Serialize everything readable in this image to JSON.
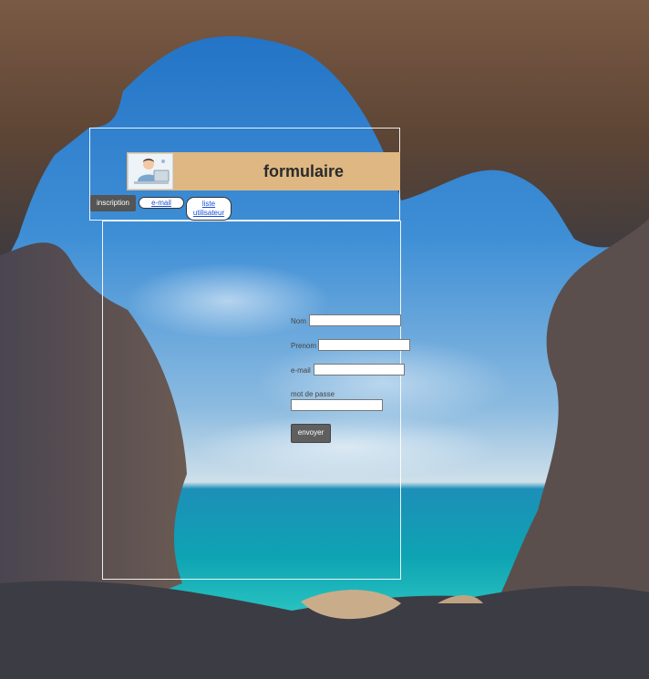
{
  "header": {
    "title": "formulaire"
  },
  "nav": {
    "inscription": "inscription",
    "email": "e-mail",
    "liste_line1": "liste",
    "liste_line2": "utilisateur"
  },
  "form": {
    "nom_label": "Nom",
    "prenom_label": "Prenom",
    "email_label": "e-mail",
    "password_label": "mot de passe",
    "submit_label": "envoyer",
    "nom_value": "",
    "prenom_value": "",
    "email_value": "",
    "password_value": ""
  },
  "colors": {
    "header_bg": "#deb783",
    "active_tab_bg": "#555555",
    "link": "#1a4ed8",
    "button_bg": "#5f5f5f"
  },
  "icons": {
    "logo": "user-at-computer-icon"
  }
}
